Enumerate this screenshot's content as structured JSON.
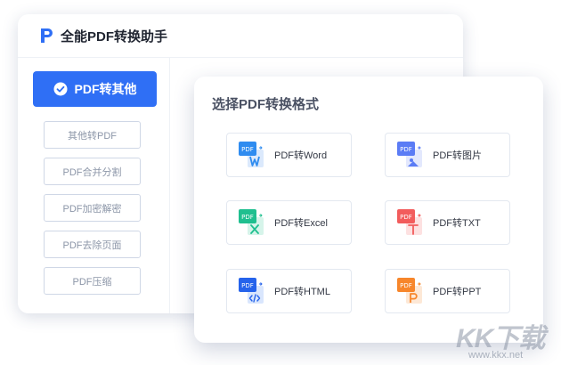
{
  "app": {
    "title": "全能PDF转换助手",
    "logo_icon": "p-logo-icon",
    "accent_color": "#2f6ff5"
  },
  "sidebar": {
    "primary": {
      "label": "PDF转其他",
      "icon": "check-circle-icon",
      "active": true
    },
    "items": [
      {
        "label": "其他转PDF"
      },
      {
        "label": "PDF合并分割"
      },
      {
        "label": "PDF加密解密"
      },
      {
        "label": "PDF去除页面"
      },
      {
        "label": "PDF压缩"
      }
    ]
  },
  "panel": {
    "title": "选择PDF转换格式",
    "options": [
      {
        "label": "PDF转Word",
        "icon": "pdf-to-word-icon",
        "color": "#2f8cf0",
        "badge": "PDF",
        "target": "W"
      },
      {
        "label": "PDF转图片",
        "icon": "pdf-to-image-icon",
        "color": "#5b7cf5",
        "badge": "PDF",
        "target": "img"
      },
      {
        "label": "PDF转Excel",
        "icon": "pdf-to-excel-icon",
        "color": "#1fbf8f",
        "badge": "PDF",
        "target": "X"
      },
      {
        "label": "PDF转TXT",
        "icon": "pdf-to-txt-icon",
        "color": "#f25c5c",
        "badge": "PDF",
        "target": "T"
      },
      {
        "label": "PDF转HTML",
        "icon": "pdf-to-html-icon",
        "color": "#2563eb",
        "badge": "PDF",
        "target": "</>"
      },
      {
        "label": "PDF转PPT",
        "icon": "pdf-to-ppt-icon",
        "color": "#f7862b",
        "badge": "PDF",
        "target": "P"
      }
    ]
  },
  "watermark": {
    "brand": "KK下载",
    "url": "www.kkx.net"
  }
}
